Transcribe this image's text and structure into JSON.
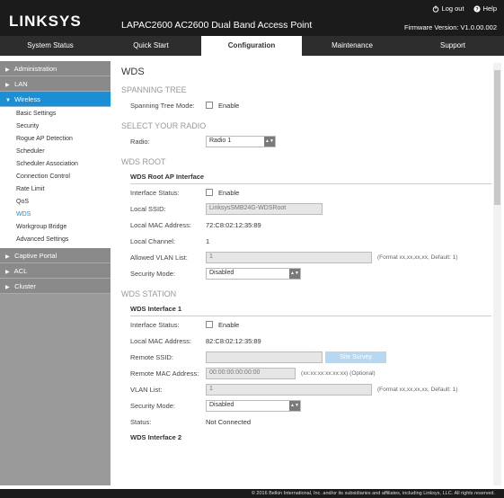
{
  "header": {
    "brand": "LINKSYS",
    "product": "LAPAC2600 AC2600 Dual Band Access Point",
    "firmware": "Firmware Version: V1.0.00.002",
    "logout": "Log out",
    "help": "Help"
  },
  "nav": {
    "tabs": [
      {
        "label": "System Status"
      },
      {
        "label": "Quick Start"
      },
      {
        "label": "Configuration"
      },
      {
        "label": "Maintenance"
      },
      {
        "label": "Support"
      }
    ],
    "active": "Configuration"
  },
  "sidebar": {
    "cats": [
      {
        "label": "Administration",
        "arrow": "▶"
      },
      {
        "label": "LAN",
        "arrow": "▶"
      },
      {
        "label": "Wireless",
        "arrow": "▼"
      },
      {
        "label": "Captive Portal",
        "arrow": "▶"
      },
      {
        "label": "ACL",
        "arrow": "▶"
      },
      {
        "label": "Cluster",
        "arrow": "▶"
      }
    ],
    "wireless_items": [
      "Basic Settings",
      "Security",
      "Rogue AP Detection",
      "Scheduler",
      "Scheduler Association",
      "Connection Control",
      "Rate Limit",
      "QoS",
      "WDS",
      "Workgroup Bridge",
      "Advanced Settings"
    ],
    "active_item": "WDS"
  },
  "main": {
    "title": "WDS",
    "spanning": {
      "heading": "SPANNING TREE",
      "label": "Spanning Tree Mode:",
      "enable": "Enable"
    },
    "radio": {
      "heading": "SELECT YOUR RADIO",
      "label": "Radio:",
      "value": "Radio 1"
    },
    "root": {
      "heading": "WDS ROOT",
      "sub": "WDS Root AP Interface",
      "status_label": "Interface Status:",
      "enable": "Enable",
      "ssid_label": "Local SSID:",
      "ssid_value": "LinksysSMB24G-WDSRoot",
      "mac_label": "Local MAC Address:",
      "mac_value": "72:C8:02:12:35:89",
      "channel_label": "Local Channel:",
      "channel_value": "1",
      "vlan_label": "Allowed VLAN List:",
      "vlan_value": "1",
      "vlan_hint": "(Format xx,xx,xx,xx, Default: 1)",
      "secmode_label": "Security Mode:",
      "secmode_value": "Disabled"
    },
    "station": {
      "heading": "WDS STATION",
      "sub": "WDS Interface 1",
      "status_label": "Interface Status:",
      "enable": "Enable",
      "mac_label": "Local MAC Address:",
      "mac_value": "82:C8:02:12:35:89",
      "rssid_label": "Remote SSID:",
      "rssid_value": "",
      "survey": "Site Survey",
      "rmac_label": "Remote MAC Address:",
      "rmac_value": "00:00:00:00:00:00",
      "rmac_hint": "(xx:xx:xx:xx:xx:xx) (Optional)",
      "vlan_label": "VLAN List:",
      "vlan_value": "1",
      "vlan_hint": "(Format xx,xx,xx,xx, Default: 1)",
      "secmode_label": "Security Mode:",
      "secmode_value": "Disabled",
      "status2_label": "Status:",
      "status2_value": "Not Connected",
      "next_sub": "WDS Interface 2"
    }
  },
  "footer": {
    "text": "© 2016 Belkin International, Inc. and/or its subsidiaries and affiliates, including Linksys, LLC. All rights reserved."
  },
  "colors": {
    "accent": "#1a8fd5",
    "header_bg": "#1b1b1b",
    "sidebar_bg": "#9a9a9a"
  }
}
